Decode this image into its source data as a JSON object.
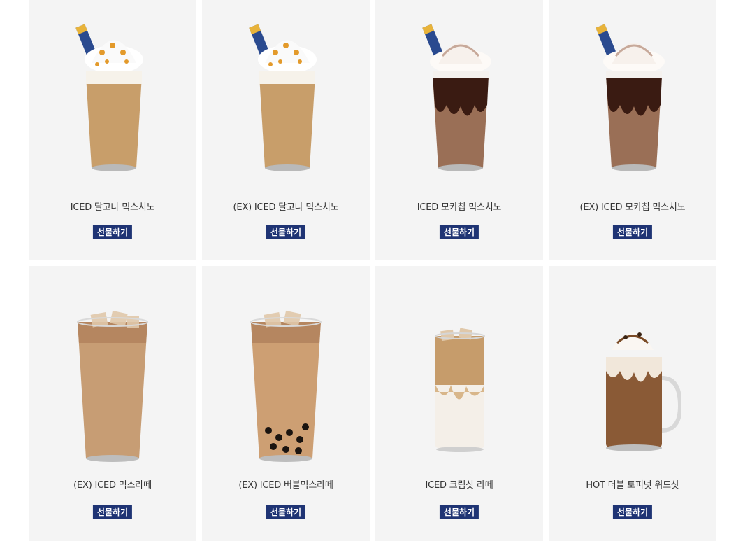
{
  "products": [
    {
      "name": "ICED 달고나 믹스치노",
      "button": "선물하기",
      "image": "dalgona-frappe-image",
      "kind": "frappe-caramel"
    },
    {
      "name": "(EX) ICED 달고나 믹스치노",
      "button": "선물하기",
      "image": "dalgona-frappe-image",
      "kind": "frappe-caramel"
    },
    {
      "name": "ICED 모카칩 믹스치노",
      "button": "선물하기",
      "image": "mocha-frappe-image",
      "kind": "frappe-mocha"
    },
    {
      "name": "(EX) ICED 모카칩 믹스치노",
      "button": "선물하기",
      "image": "mocha-frappe-image",
      "kind": "frappe-mocha"
    },
    {
      "name": "(EX) ICED 믹스라떼",
      "button": "선물하기",
      "image": "iced-latte-image",
      "kind": "iced-latte"
    },
    {
      "name": "(EX) ICED 버블믹스라떼",
      "button": "선물하기",
      "image": "bubble-latte-image",
      "kind": "bubble-latte"
    },
    {
      "name": "ICED 크림샷 라떼",
      "button": "선물하기",
      "image": "cream-shot-latte-image",
      "kind": "cream-latte"
    },
    {
      "name": "HOT 더블 토피넛 위드샷",
      "button": "선물하기",
      "image": "toffee-nut-mug-image",
      "kind": "hot-mug"
    }
  ],
  "colors": {
    "card_bg": "#f4f4f4",
    "button_bg": "#1f3474",
    "button_text": "#ffffff",
    "name_text": "#333333"
  }
}
